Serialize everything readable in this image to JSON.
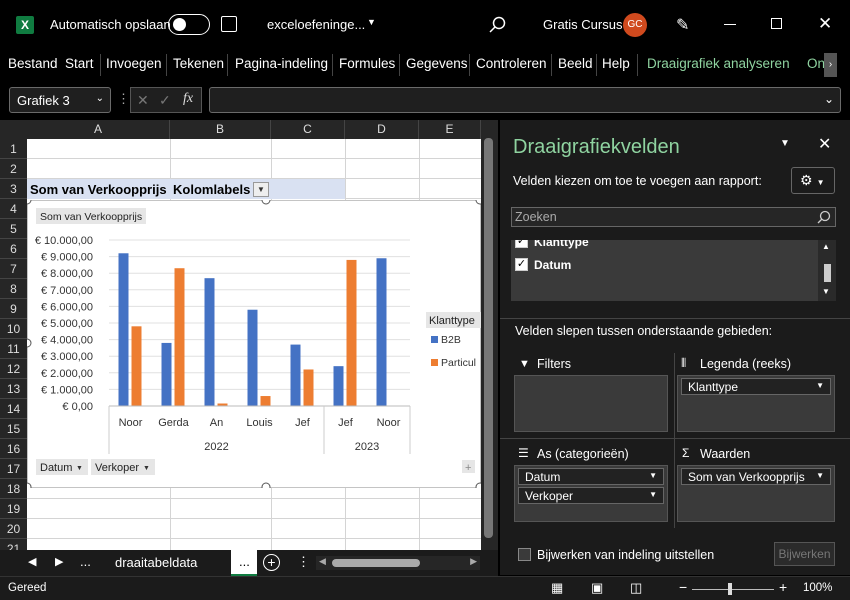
{
  "titlebar": {
    "autosave": "Automatisch opslaan",
    "filename": "exceloefeninge...",
    "user": "Gratis Cursus",
    "avatar": "GC"
  },
  "ribbon": {
    "tabs": [
      "Bestand",
      "Start",
      "Invoegen",
      "Tekenen",
      "Pagina-indeling",
      "Formules",
      "Gegevens",
      "Controleren",
      "Beeld",
      "Help",
      "Draaigrafiek analyseren",
      "On"
    ]
  },
  "formula_bar": {
    "name_box": "Grafiek 3",
    "fx": "fx"
  },
  "grid": {
    "columns": [
      "A",
      "B",
      "C",
      "D",
      "E"
    ],
    "rows": [
      "1",
      "2",
      "3",
      "4",
      "5",
      "6",
      "7",
      "8",
      "9",
      "10",
      "11",
      "12",
      "13",
      "14",
      "15",
      "16",
      "17",
      "18",
      "19",
      "20",
      "21"
    ],
    "a3": "Som van Verkoopprijs",
    "b3": "Kolomlabels"
  },
  "chart_data": {
    "type": "bar",
    "title": "Som van Verkoopprijs",
    "categories": [
      "Noor",
      "Gerda",
      "An",
      "Louis",
      "Jef",
      "Jef",
      "Noor"
    ],
    "groups": [
      {
        "label": "2022",
        "span": 5
      },
      {
        "label": "2023",
        "span": 2
      }
    ],
    "series": [
      {
        "name": "B2B",
        "color": "#4472C4",
        "values": [
          9200,
          3800,
          7700,
          5800,
          3700,
          2400,
          8900
        ]
      },
      {
        "name": "Particulier",
        "color": "#ED7D31",
        "values": [
          4800,
          8300,
          150,
          600,
          2200,
          8800,
          0
        ]
      }
    ],
    "yticks": [
      "€ 0,00",
      "€ 1.000,00",
      "€ 2.000,00",
      "€ 3.000,00",
      "€ 4.000,00",
      "€ 5.000,00",
      "€ 6.000,00",
      "€ 7.000,00",
      "€ 8.000,00",
      "€ 9.000,00",
      "€ 10.000,00"
    ],
    "ylim": [
      0,
      10000
    ],
    "legend_title": "Klanttype",
    "legend_items": [
      "B2B",
      "Particul"
    ],
    "filter_buttons": [
      "Datum",
      "Verkoper"
    ]
  },
  "pane": {
    "title": "Draaigrafiekvelden",
    "subtitle": "Velden kiezen om toe te voegen aan rapport:",
    "search": "Zoeken",
    "fields": [
      "Klanttype",
      "Datum"
    ],
    "drag_label": "Velden slepen tussen onderstaande gebieden:",
    "filters": "Filters",
    "legend": "Legenda (reeks)",
    "legend_field": "Klanttype",
    "axis": "As (categorieën)",
    "axis_fields": [
      "Datum",
      "Verkoper"
    ],
    "values": "Waarden",
    "values_field": "Som van Verkoopprijs",
    "defer": "Bijwerken van indeling uitstellen",
    "update": "Bijwerken"
  },
  "sheet_tabs": {
    "active": "draaitabeldata",
    "more": "..."
  },
  "status": {
    "ready": "Gereed",
    "zoom": "100%"
  }
}
